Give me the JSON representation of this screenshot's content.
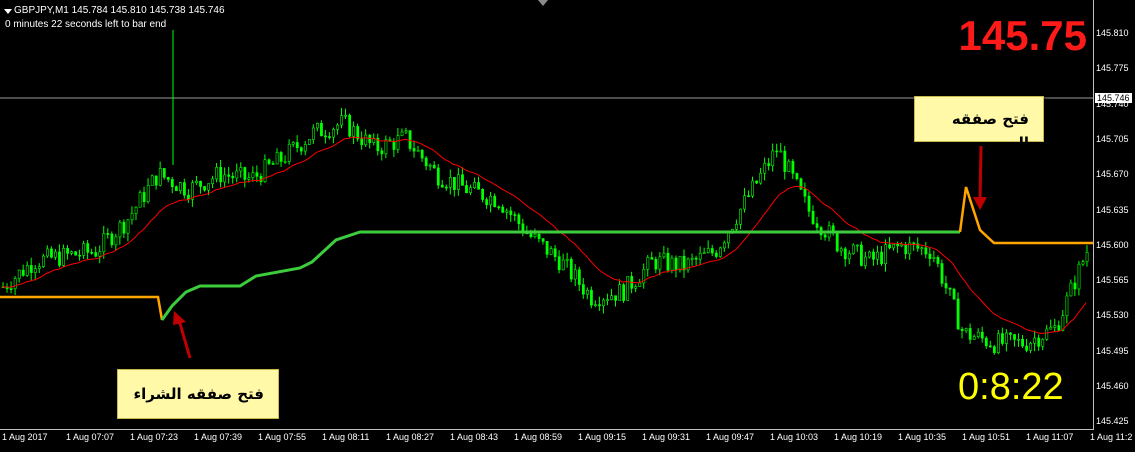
{
  "header": {
    "symbol_line": "GBPJPY,M1  145.784 145.810 145.738 145.746",
    "timer_line": "0 minutes 22 seconds left to bar end"
  },
  "big_price": "145.75",
  "countdown": "0:8:22",
  "notes": {
    "buy": "فتح صفقه الشراء",
    "sell": "فتح صفقه البيع"
  },
  "current_price": "145.746",
  "colors": {
    "background": "#000000",
    "candles": "#00ff00",
    "ma_red": "#ff0000",
    "line_green": "#3ccc3c",
    "line_orange": "#ffa500",
    "arrow": "#c00000",
    "big_price": "#ff1a1a",
    "countdown": "#ffff00"
  },
  "price_axis": {
    "range": [
      145.425,
      145.845
    ],
    "ticks": [
      "145.810",
      "145.775",
      "145.740",
      "145.705",
      "145.670",
      "145.635",
      "145.600",
      "145.565",
      "145.530",
      "145.495",
      "145.460",
      "145.425"
    ]
  },
  "time_axis": {
    "labels": [
      "1 Aug 2017",
      "1 Aug 07:07",
      "1 Aug 07:23",
      "1 Aug 07:39",
      "1 Aug 07:55",
      "1 Aug 08:11",
      "1 Aug 08:27",
      "1 Aug 08:43",
      "1 Aug 08:59",
      "1 Aug 09:15",
      "1 Aug 09:31",
      "1 Aug 09:47",
      "1 Aug 10:03",
      "1 Aug 10:19",
      "1 Aug 10:35",
      "1 Aug 10:51",
      "1 Aug 11:07",
      "1 Aug 11:2"
    ]
  },
  "chart_data": {
    "type": "line",
    "title": "GBPJPY,M1",
    "ylim": [
      145.425,
      145.845
    ],
    "current_price": 145.746,
    "series": [
      {
        "x": [
          "06:52",
          "07:00",
          "07:07",
          "07:15",
          "07:20",
          "07:23",
          "07:30",
          "07:39",
          "07:50",
          "07:55",
          "08:05",
          "08:11",
          "08:20",
          "08:27",
          "08:35",
          "08:43",
          "08:50",
          "08:59",
          "09:05",
          "09:15",
          "09:25",
          "09:31",
          "09:40",
          "09:47",
          "09:55",
          "10:03",
          "10:10",
          "10:19",
          "10:27",
          "10:35",
          "10:45",
          "10:51",
          "11:00",
          "11:07",
          "11:15",
          "11:20"
        ],
        "values": [
          145.565,
          145.59,
          145.595,
          145.6,
          145.63,
          145.675,
          145.66,
          145.675,
          145.67,
          145.69,
          145.715,
          145.725,
          145.7,
          145.71,
          145.675,
          145.66,
          145.65,
          145.615,
          145.59,
          145.555,
          145.56,
          145.59,
          145.585,
          145.6,
          145.65,
          145.7,
          145.64,
          145.605,
          145.59,
          145.605,
          145.6,
          145.52,
          145.51,
          145.51,
          145.525,
          145.6
        ]
      }
    ]
  }
}
